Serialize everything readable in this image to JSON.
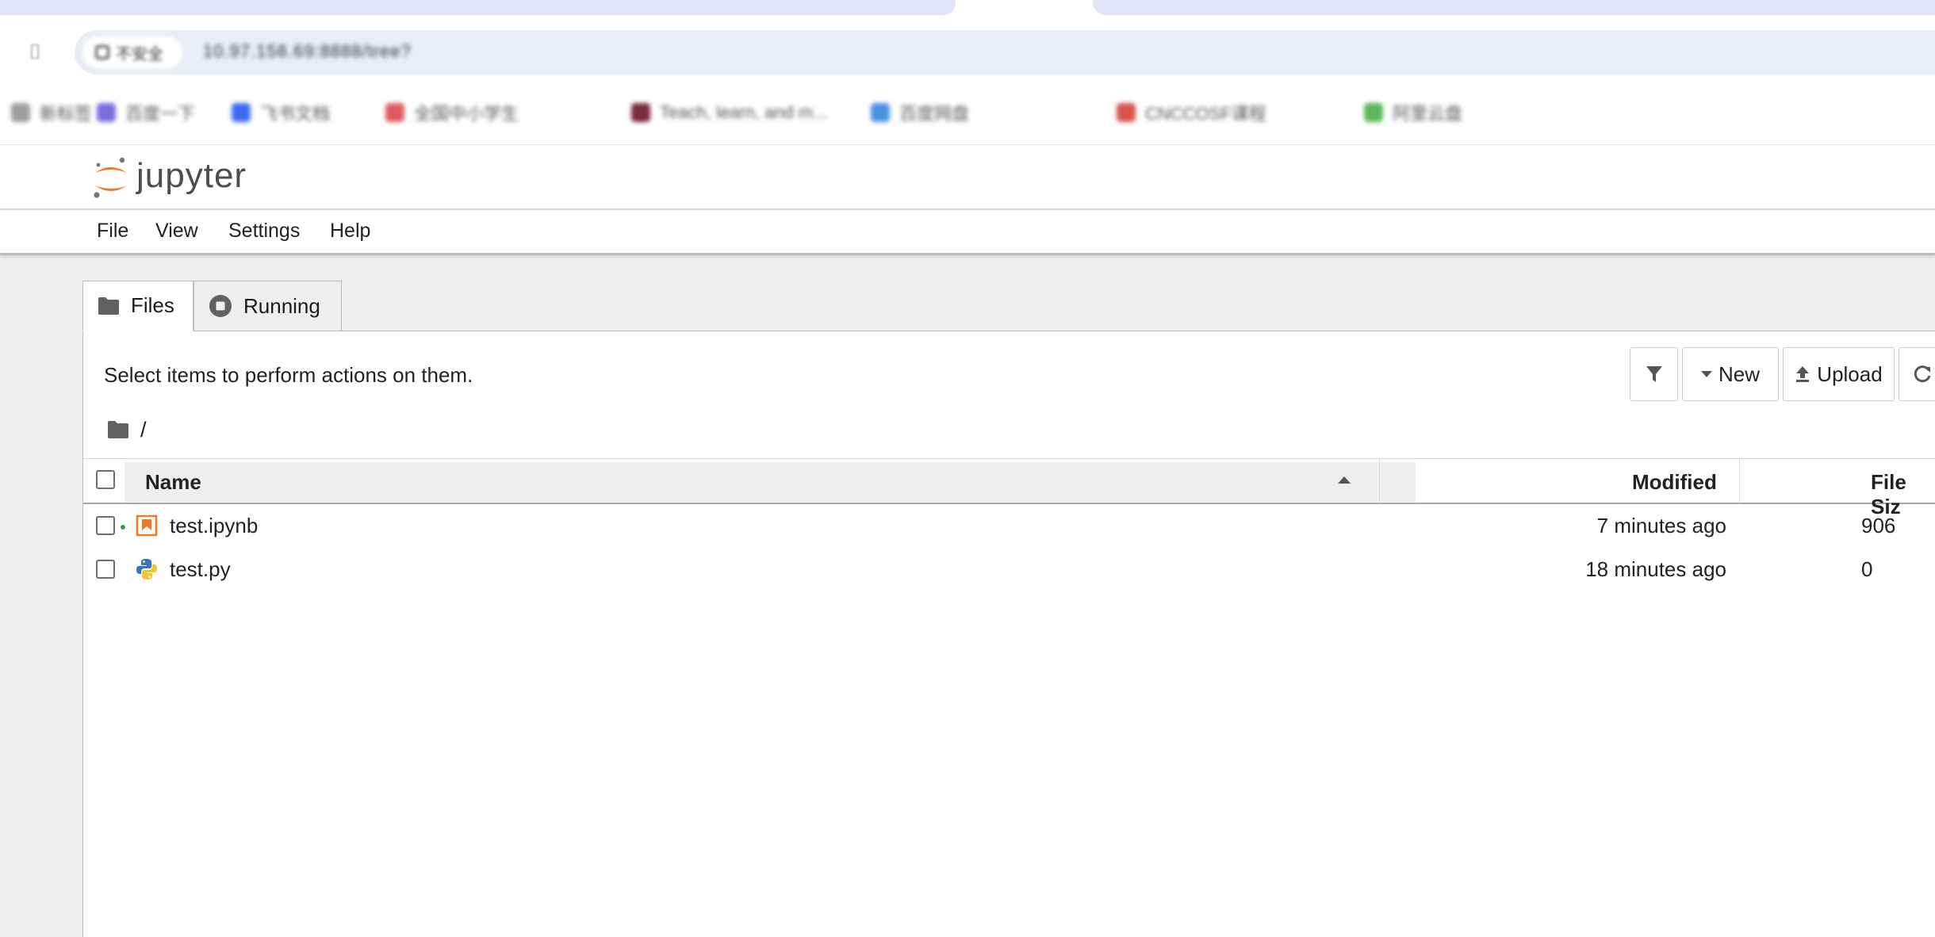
{
  "browser": {
    "reader_icon": "reader-mode-icon",
    "security_label": "不安全",
    "url": "10.97.158.69:8888/tree?",
    "bookmarks": [
      {
        "label": "新标签",
        "color": "#9e9e9e"
      },
      {
        "label": "百度一下",
        "color": "#7b6fe0"
      },
      {
        "label": "飞书文档",
        "color": "#3d6df2"
      },
      {
        "label": "全国中小学生",
        "color": "#e05a5a"
      },
      {
        "label": "Teach, learn, and m...",
        "color": "#7a2a3a"
      },
      {
        "label": "百度网盘",
        "color": "#4a90e2"
      },
      {
        "label": "CNCCOSF课程",
        "color": "#d9534f"
      },
      {
        "label": "阿里云盘",
        "color": "#5cb85c"
      }
    ]
  },
  "header": {
    "logo_text": "jupyter",
    "logo_colors": {
      "orange": "#f37726",
      "gray": "#767677"
    }
  },
  "menu": {
    "items": [
      "File",
      "View",
      "Settings",
      "Help"
    ]
  },
  "tabs": {
    "files": "Files",
    "running": "Running"
  },
  "toolbar": {
    "hint": "Select items to perform actions on them.",
    "filter_icon": "filter-icon",
    "new_label": "New",
    "upload_label": "Upload",
    "refresh_icon": "refresh-icon"
  },
  "breadcrumb": {
    "separator": "/"
  },
  "table": {
    "columns": {
      "name": "Name",
      "modified": "Modified",
      "size": "File Siz"
    },
    "sort": "name-ascending",
    "rows": [
      {
        "name": "test.ipynb",
        "modified": "7 minutes ago",
        "size": "906",
        "kind": "notebook",
        "running": true
      },
      {
        "name": "test.py",
        "modified": "18 minutes ago",
        "size": "0",
        "kind": "python",
        "running": false
      }
    ]
  }
}
